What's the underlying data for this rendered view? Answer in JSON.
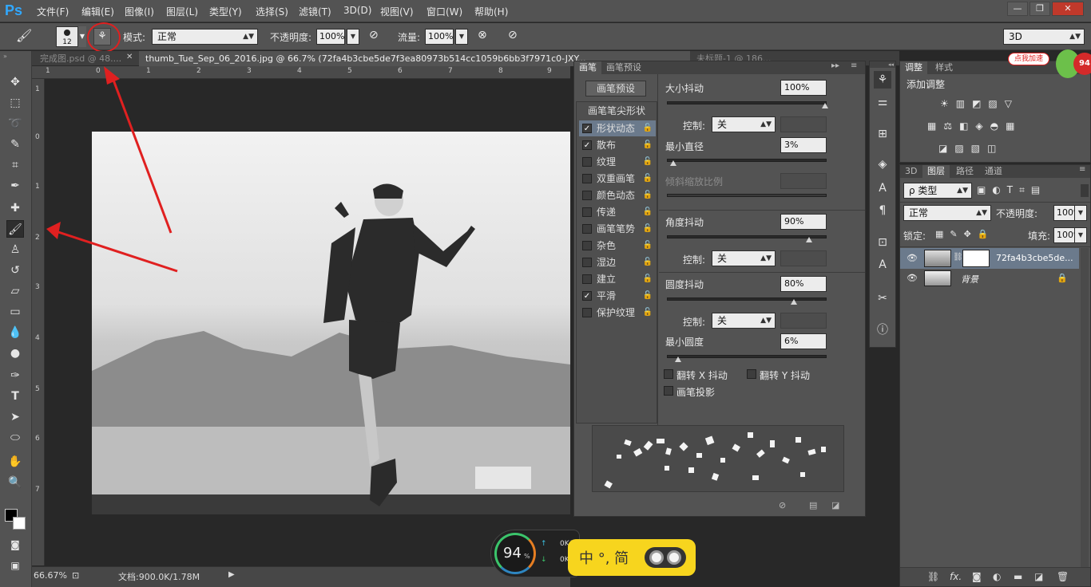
{
  "app": {
    "logo": "Ps"
  },
  "menu": [
    "文件(F)",
    "编辑(E)",
    "图像(I)",
    "图层(L)",
    "类型(Y)",
    "选择(S)",
    "滤镜(T)",
    "3D(D)",
    "视图(V)",
    "窗口(W)",
    "帮助(H)"
  ],
  "window_controls": {
    "minimize": "—",
    "restore": "❐",
    "close": "✕"
  },
  "options": {
    "brush_size": "12",
    "mode_label": "模式:",
    "mode_value": "正常",
    "opacity_label": "不透明度:",
    "opacity_value": "100%",
    "flow_label": "流量:",
    "flow_value": "100%",
    "workspace": "3D"
  },
  "tabs": [
    {
      "label": "完成图.psd @ 48...."
    },
    {
      "label": "thumb_Tue_Sep_06_2016.jpg @ 66.7% (72fa4b3cbe5de7f3ea80973b514cc1059b6bb3f7971c0-JXY..."
    },
    {
      "label": "未标题-1 @ 186..."
    }
  ],
  "tab_close": "✕",
  "ruler": {
    "h": [
      "1",
      "0",
      "1",
      "2",
      "3",
      "4",
      "5",
      "6",
      "7",
      "8",
      "9",
      "10"
    ],
    "v": [
      "1",
      "0",
      "1",
      "2",
      "3",
      "4",
      "5",
      "6",
      "7",
      "8"
    ]
  },
  "status": {
    "zoom": "66.67%",
    "doc": "文档:900.0K/1.78M"
  },
  "brush_panel": {
    "tabs": [
      "画笔",
      "画笔预设"
    ],
    "preset_button": "画笔预设",
    "tip_shape": "画笔笔尖形状",
    "items": [
      {
        "label": "形状动态",
        "checked": true
      },
      {
        "label": "散布",
        "checked": true
      },
      {
        "label": "纹理",
        "checked": false
      },
      {
        "label": "双重画笔",
        "checked": false
      },
      {
        "label": "颜色动态",
        "checked": false
      },
      {
        "label": "传递",
        "checked": false
      },
      {
        "label": "画笔笔势",
        "checked": false
      },
      {
        "label": "杂色",
        "checked": false
      },
      {
        "label": "湿边",
        "checked": false
      },
      {
        "label": "建立",
        "checked": false
      },
      {
        "label": "平滑",
        "checked": true
      },
      {
        "label": "保护纹理",
        "checked": false
      }
    ],
    "check_mark": "✓",
    "size_jitter": {
      "label": "大小抖动",
      "value": "100%",
      "level": 1.0
    },
    "control1": {
      "label": "控制:",
      "value": "关"
    },
    "min_diameter": {
      "label": "最小直径",
      "value": "3%",
      "level": 0.03
    },
    "tilt_scale": {
      "label": "倾斜缩放比例"
    },
    "angle_jitter": {
      "label": "角度抖动",
      "value": "90%",
      "level": 0.9
    },
    "control2": {
      "label": "控制:",
      "value": "关"
    },
    "roundness_jitter": {
      "label": "圆度抖动",
      "value": "80%",
      "level": 0.8
    },
    "control3": {
      "label": "控制:",
      "value": "关"
    },
    "min_roundness": {
      "label": "最小圆度",
      "value": "6%",
      "level": 0.06
    },
    "flip_x": "翻转 X 抖动",
    "flip_y": "翻转 Y 抖动",
    "brush_projection": "画笔投影"
  },
  "adjust_panel": {
    "tabs": [
      "调整",
      "样式"
    ],
    "title": "添加调整"
  },
  "layers_panel": {
    "tabs": [
      "3D",
      "图层",
      "路径",
      "通道"
    ],
    "filter": "ρ 类型",
    "blend": "正常",
    "opacity_label": "不透明度:",
    "opacity_value": "100%",
    "lock_label": "锁定:",
    "fill_label": "填充:",
    "fill_value": "100%",
    "layers": [
      {
        "name": "72fa4b3cbe5de...",
        "selected": true
      },
      {
        "name": "背景",
        "selected": false
      }
    ],
    "footer_fx": "fx."
  },
  "widgets": {
    "net_percent": "94",
    "net_unit": "%",
    "up_speed": "0K/s",
    "down_speed": "0K/s",
    "ime_text": "中 °, 简",
    "promo": "点我加速",
    "promo_num": "94"
  },
  "colors": {
    "accent_red": "#e02020",
    "ps_blue": "#31a8ff"
  }
}
